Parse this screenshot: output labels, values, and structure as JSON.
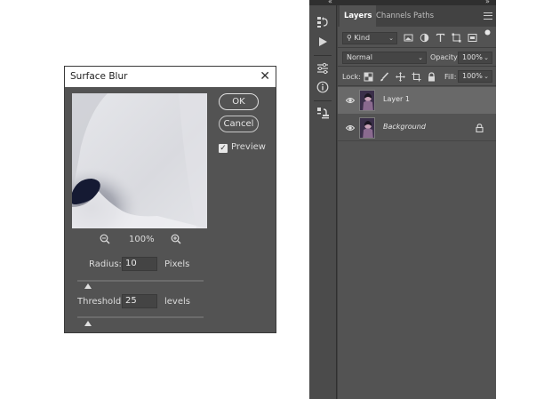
{
  "dialog": {
    "title": "Surface Blur",
    "close_glyph": "✕",
    "ok_label": "OK",
    "cancel_label": "Cancel",
    "preview_label": "Preview",
    "preview_checked": true,
    "zoom_level": "100%",
    "radius_label": "Radius:",
    "radius_value": "10",
    "radius_unit": "Pixels",
    "threshold_label": "Threshold:",
    "threshold_value": "25",
    "threshold_unit": "levels",
    "icons": [
      "zoom-out-icon",
      "zoom-in-icon",
      "checkbox-check-icon",
      "close-icon"
    ]
  },
  "panel": {
    "collapse_left": "«",
    "collapse_right": "»",
    "tabs": [
      {
        "label": "Layers",
        "active": true
      },
      {
        "label": "Channels",
        "active": false
      },
      {
        "label": "Paths",
        "active": false
      }
    ],
    "filter": {
      "kind_label": "Kind",
      "search_glyph": "⚲"
    },
    "blend_mode": "Normal",
    "opacity_label": "Opacity:",
    "opacity_value": "100%",
    "lock_label": "Lock:",
    "fill_label": "Fill:",
    "fill_value": "100%",
    "layers": [
      {
        "name": "Layer 1",
        "selected": true,
        "locked": false
      },
      {
        "name": "Background",
        "selected": false,
        "locked": true
      }
    ],
    "tool_icons": [
      "history-icon",
      "play-action-icon",
      "adjustments-icon",
      "info-icon",
      "clone-source-icon"
    ],
    "accent_color": "#535353"
  }
}
